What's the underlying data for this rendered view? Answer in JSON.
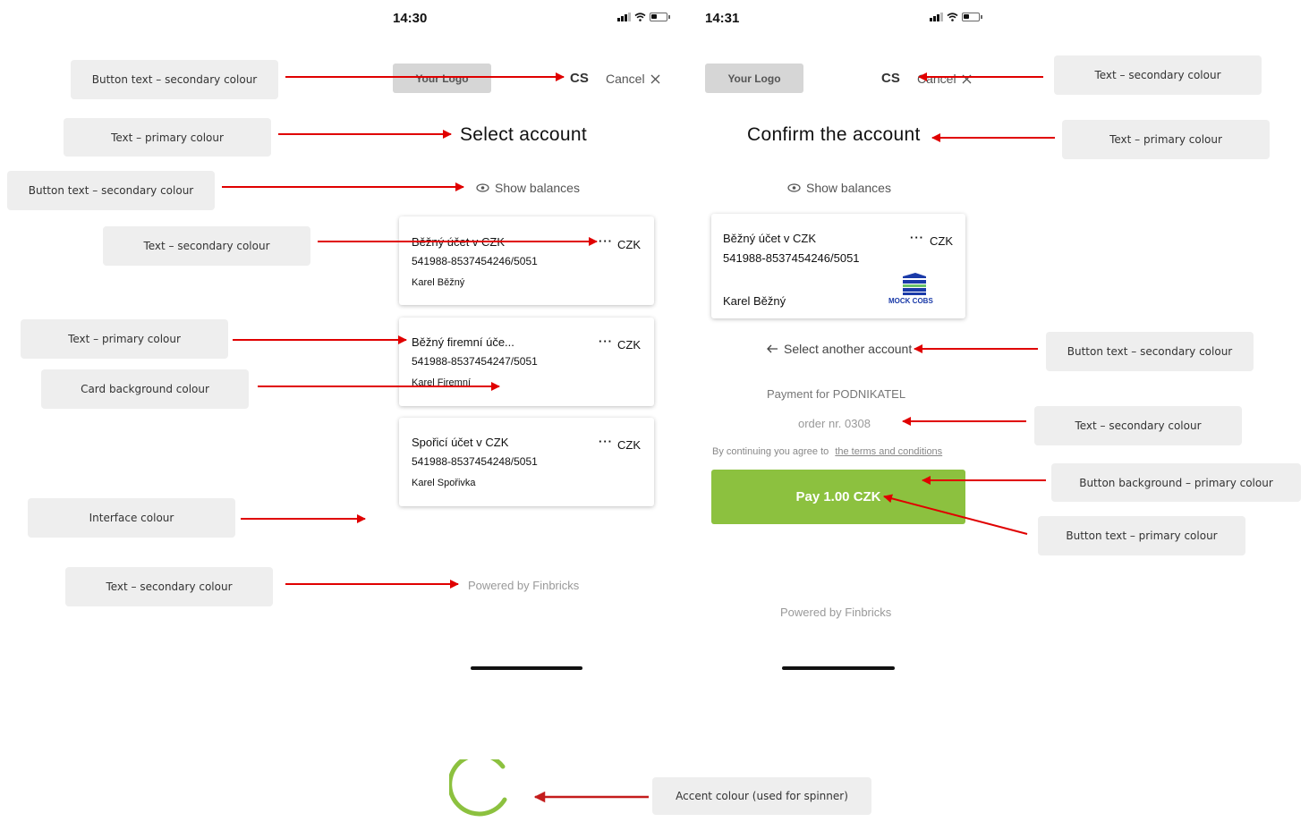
{
  "colors": {
    "arrow": "#e00000",
    "accent": "#8cc13f",
    "label_bg": "#eeeeee"
  },
  "left_screen": {
    "status_time": "14:30",
    "logo": "Your Logo",
    "lang": "CS",
    "cancel": "Cancel",
    "title": "Select account",
    "show_balances": "Show balances",
    "accounts": [
      {
        "name": "Běžný účet v CZK",
        "number": "541988-8537454246/5051",
        "owner": "Karel Běžný",
        "currency": "CZK"
      },
      {
        "name": "Běžný firemní úče...",
        "number": "541988-8537454247/5051",
        "owner": "Karel Firemní",
        "currency": "CZK"
      },
      {
        "name": "Spořicí účet v CZK",
        "number": "541988-8537454248/5051",
        "owner": "Karel Spořivka",
        "currency": "CZK"
      }
    ],
    "powered_by": "Powered by Finbricks"
  },
  "right_screen": {
    "status_time": "14:31",
    "logo": "Your Logo",
    "lang": "CS",
    "cancel": "Cancel",
    "title": "Confirm the account",
    "show_balances": "Show balances",
    "account": {
      "name": "Běžný účet v CZK",
      "number": "541988-8537454246/5051",
      "owner": "Karel Běžný",
      "currency": "CZK",
      "bank_logo": "MOCK COBS"
    },
    "select_another": "Select another account",
    "payment_for": "Payment for PODNIKATEL",
    "order": "order nr. 0308",
    "terms_prefix": "By continuing you agree to",
    "terms_link": "the terms and conditions",
    "pay_button": "Pay 1.00 CZK",
    "powered_by": "Powered by Finbricks"
  },
  "annotations": {
    "l1": "Button text – secondary colour",
    "l2": "Text – primary colour",
    "l3": "Button text – secondary colour",
    "l4": "Text – secondary colour",
    "l5": "Text – primary colour",
    "l6": "Card background colour",
    "l7": "Interface colour",
    "l8": "Text – secondary colour",
    "r1": "Text – secondary colour",
    "r2": "Text – primary colour",
    "r3": "Button text – secondary colour",
    "r4": "Text – secondary colour",
    "r5": "Button background – primary colour",
    "r6": "Button text – primary colour",
    "spinner": "Accent colour (used for spinner)"
  }
}
